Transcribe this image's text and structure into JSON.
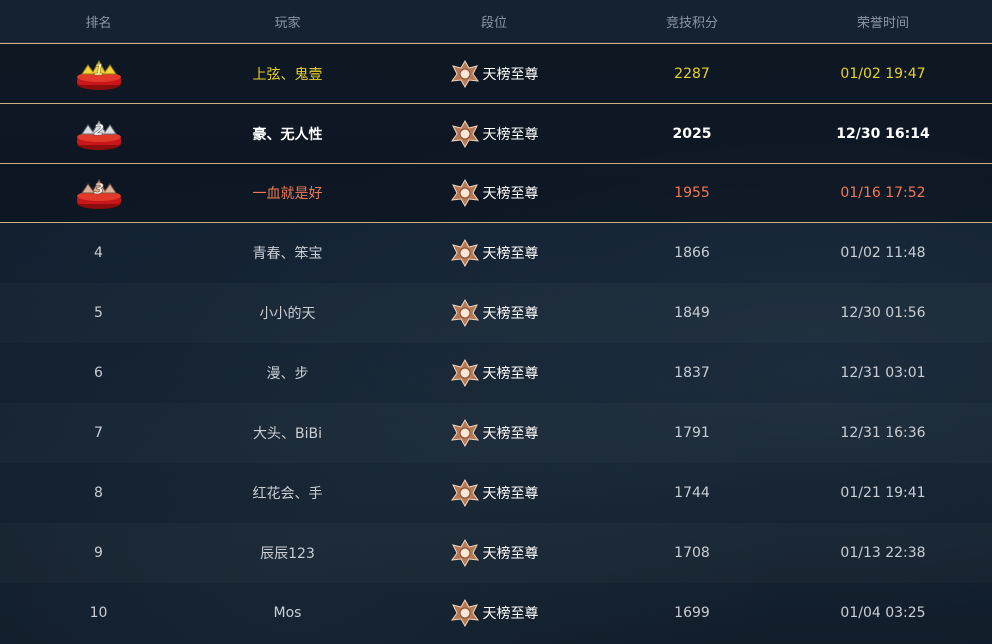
{
  "header": {
    "rank": "排名",
    "player": "玩家",
    "tier": "段位",
    "score": "竞技积分",
    "time": "荣誉时间"
  },
  "rows": [
    {
      "rank": "1",
      "player": "上弦、鬼壹",
      "tier": "天榜至尊",
      "score": "2287",
      "time": "01/02 19:47"
    },
    {
      "rank": "2",
      "player": "豪、无人性",
      "tier": "天榜至尊",
      "score": "2025",
      "time": "12/30 16:14"
    },
    {
      "rank": "3",
      "player": "一血就是好",
      "tier": "天榜至尊",
      "score": "1955",
      "time": "01/16 17:52"
    },
    {
      "rank": "4",
      "player": "青春、笨宝",
      "tier": "天榜至尊",
      "score": "1866",
      "time": "01/02 11:48"
    },
    {
      "rank": "5",
      "player": "小小的天",
      "tier": "天榜至尊",
      "score": "1849",
      "time": "12/30 01:56"
    },
    {
      "rank": "6",
      "player": "漫、步",
      "tier": "天榜至尊",
      "score": "1837",
      "time": "12/31 03:01"
    },
    {
      "rank": "7",
      "player": "大头、BiBi",
      "tier": "天榜至尊",
      "score": "1791",
      "time": "12/31 16:36"
    },
    {
      "rank": "8",
      "player": "红花会、手",
      "tier": "天榜至尊",
      "score": "1744",
      "time": "01/21 19:41"
    },
    {
      "rank": "9",
      "player": "辰辰123",
      "tier": "天榜至尊",
      "score": "1708",
      "time": "01/13 22:38"
    },
    {
      "rank": "10",
      "player": "Mos",
      "tier": "天榜至尊",
      "score": "1699",
      "time": "01/04 03:25"
    }
  ],
  "icons": {
    "medal_1": "gold-medal-icon",
    "medal_2": "silver-medal-icon",
    "medal_3": "bronze-medal-icon",
    "tier": "tier-emblem-icon"
  },
  "colors": {
    "rank1": "#e8d22a",
    "rank2": "#ffffff",
    "rank3": "#f07a55",
    "divider": "#c9b17d"
  }
}
